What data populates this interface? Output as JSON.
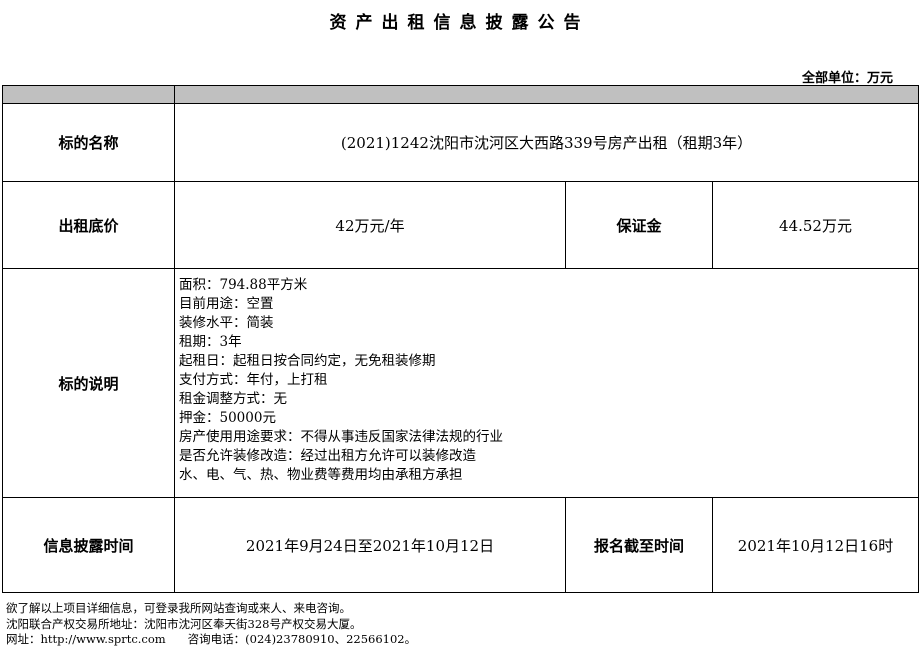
{
  "title": "资产出租信息披露公告",
  "unit_label": "全部单位：万元",
  "rows": {
    "name_label": "标的名称",
    "name_value": "(2021)1242沈阳市沈河区大西路339号房产出租（租期3年）",
    "price_label": "出租底价",
    "price_value": "42万元/年",
    "deposit_label": "保证金",
    "deposit_value": "44.52万元",
    "desc_label": "标的说明",
    "desc_lines": [
      "面积：794.88平方米",
      "目前用途：空置",
      "装修水平：简装",
      "租期：3年",
      "起租日：起租日按合同约定，无免租装修期",
      "支付方式：年付，上打租",
      "租金调整方式：无",
      "押金：50000元",
      "房产使用用途要求：不得从事违反国家法律法规的行业",
      "是否允许装修改造：经过出租方允许可以装修改造",
      "水、电、气、热、物业费等费用均由承租方承担"
    ],
    "period_label": "信息披露时间",
    "period_value": "2021年9月24日至2021年10月12日",
    "deadline_label": "报名截至时间",
    "deadline_value": "2021年10月12日16时"
  },
  "footer": {
    "line1": "欲了解以上项目详细信息，可登录我所网站查询或来人、来电咨询。",
    "line2": "沈阳联合产权交易所地址：沈阳市沈河区奉天街328号产权交易大厦。",
    "line3": "网址：http://www.sprtc.com      咨询电话：(024)23780910、22566102。"
  }
}
